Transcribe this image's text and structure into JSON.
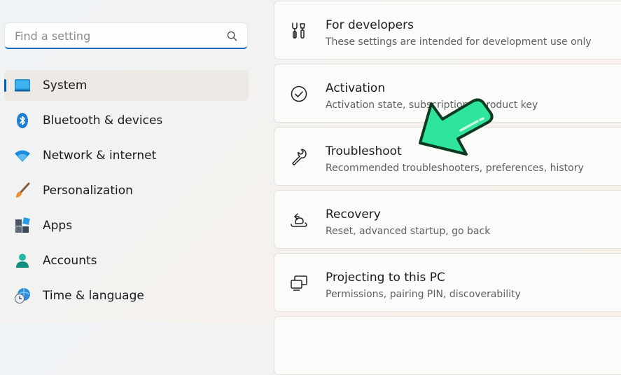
{
  "search": {
    "placeholder": "Find a setting",
    "icon": "search-icon"
  },
  "sidebar": {
    "items": [
      {
        "label": "System",
        "icon": "system-monitor-icon",
        "selected": true
      },
      {
        "label": "Bluetooth & devices",
        "icon": "bluetooth-icon"
      },
      {
        "label": "Network & internet",
        "icon": "wifi-icon"
      },
      {
        "label": "Personalization",
        "icon": "paintbrush-icon"
      },
      {
        "label": "Apps",
        "icon": "apps-icon"
      },
      {
        "label": "Accounts",
        "icon": "account-icon"
      },
      {
        "label": "Time & language",
        "icon": "time-language-icon"
      }
    ]
  },
  "main": {
    "cards": [
      {
        "title": "For developers",
        "subtitle": "These settings are intended for development use only",
        "icon": "developer-tools-icon"
      },
      {
        "title": "Activation",
        "subtitle": "Activation state, subscriptions, product key",
        "icon": "checkmark-circle-icon"
      },
      {
        "title": "Troubleshoot",
        "subtitle": "Recommended troubleshooters, preferences, history",
        "icon": "wrench-icon"
      },
      {
        "title": "Recovery",
        "subtitle": "Reset, advanced startup, go back",
        "icon": "recovery-icon"
      },
      {
        "title": "Projecting to this PC",
        "subtitle": "Permissions, pairing PIN, discoverability",
        "icon": "projecting-icon"
      }
    ]
  },
  "colors": {
    "accent": "#005fb8",
    "arrow": "#2ee59d",
    "arrow_outline": "#0c3b22"
  }
}
